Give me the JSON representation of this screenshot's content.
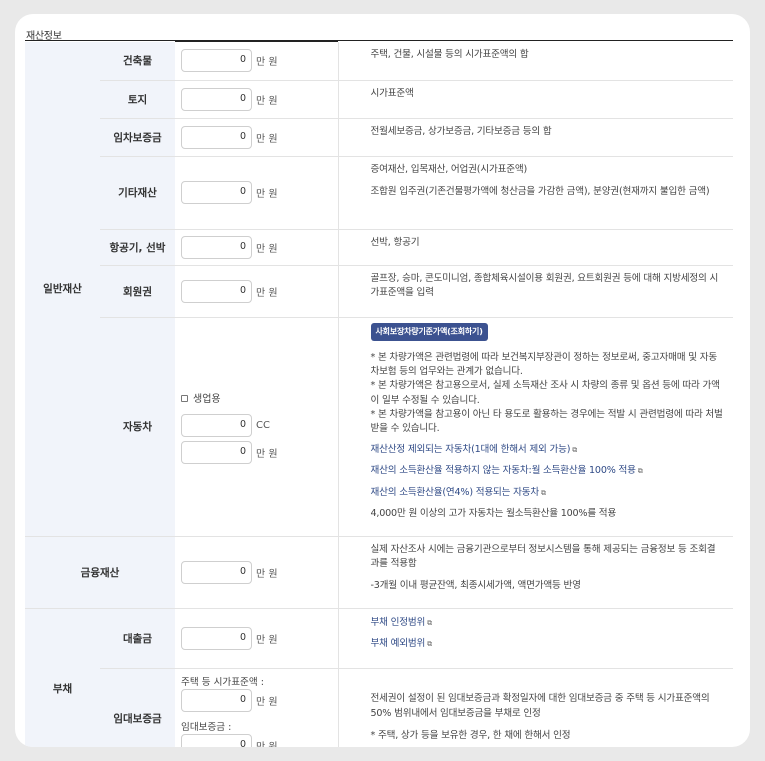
{
  "section_title": "재산정보",
  "general_label": "일반재산",
  "rows": {
    "building": {
      "label": "건축물",
      "value": "0",
      "unit": "만 원",
      "desc": "주택, 건물, 시설물 등의 시가표준액의 합"
    },
    "land": {
      "label": "토지",
      "value": "0",
      "unit": "만 원",
      "desc": "시가표준액"
    },
    "deposit": {
      "label": "임차보증금",
      "value": "0",
      "unit": "만 원",
      "desc": "전월세보증금, 상가보증금, 기타보증금 등의 합"
    },
    "other": {
      "label": "기타재산",
      "value": "0",
      "unit": "만 원",
      "desc1": "증여재산, 입목재산, 어업권(시가표준액)",
      "desc2": "조합원 입주권(기존건물평가액에 청산금을 가감한 금액), 분양권(현재까지 불입한 금액)"
    },
    "aircraft": {
      "label": "항공기, 선박",
      "value": "0",
      "unit": "만 원",
      "desc": "선박, 항공기"
    },
    "membership": {
      "label": "회원권",
      "value": "0",
      "unit": "만 원",
      "desc": "골프장, 승마, 콘도미니엄, 종합체육시설이용 회원권, 요트회원권 등에 대해 지방세정의 시가표준액을 입력"
    },
    "car": {
      "label": "자동차",
      "business_label": "생업용",
      "cc_value": "0",
      "cc_unit": "CC",
      "value": "0",
      "unit": "만 원",
      "button": "사회보장차량기준가액(조회하기)",
      "note1": "* 본 차량가액은 관련법령에 따라 보건복지부장관이 정하는 정보로써, 중고자매매 및 자동차보험 등의 업무와는 관계가 없습니다.",
      "note2": "* 본 차량가액은 참고용으로서, 실제 소득재산 조사 시 차량의 종류 및 옵션 등에 따라 가액이 일부 수정될 수 있습니다.",
      "note3": "* 본 차량가액을 참고용이 아닌 타 용도로 활용하는 경우에는 적발 시 관련법령에 따라 처벌받을 수 있습니다.",
      "link1": "재산산정 제외되는 자동차(1대에 한해서 제외 가능)",
      "link2": "재산의 소득환산율 적용하지 않는 자동차:월 소득환산율 100% 적용",
      "link3": "재산의 소득환산율(연4%) 적용되는 자동차",
      "note4": "4,000만 원 이상의 고가 자동차는 월소득환산율 100%를 적용"
    }
  },
  "finance": {
    "label": "금융재산",
    "value": "0",
    "unit": "만 원",
    "desc1": "실제 자산조사 시에는 금융기관으로부터 정보시스템을 통해 제공되는 금융정보 등 조회결과를 적용함",
    "desc2": "-3개월 이내 평균잔액, 최종시세가액, 액면가액등 반영"
  },
  "debt": {
    "label": "부채",
    "loan": {
      "label": "대출금",
      "value": "0",
      "unit": "만 원",
      "link1": "부채 인정범위",
      "link2": "부채 예외범위"
    },
    "lease": {
      "label": "임대보증금",
      "sub1_label": "주택 등 시가표준액 :",
      "sub1_value": "0",
      "sub2_label": "임대보증금 :",
      "sub2_value": "0",
      "unit": "만 원",
      "desc1": "전세권이 설정이 된 임대보증금과 확정일자에 대한 임대보증금 중 주택 등 시가표준액의 50% 범위내에서 임대보증금을 부채로 인정",
      "desc2": "* 주택, 상가 등을 보유한 경우, 한 채에 한해서 인정"
    }
  },
  "icons": {
    "external": "external-link-icon",
    "checkbox": "checkbox-icon"
  },
  "colors": {
    "accent": "#3c5290",
    "label_bg": "#f1f4fa",
    "link": "#2f4a86"
  }
}
